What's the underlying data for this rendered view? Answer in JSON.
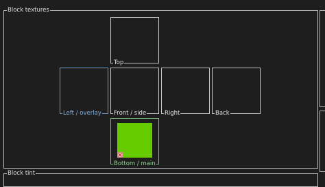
{
  "panels": {
    "block_textures_title": "Block textures",
    "block_tint_title": "Block tint"
  },
  "slots": {
    "top": "Top",
    "left": "Left / overlay",
    "front": "Front / side",
    "right": "Right",
    "back": "Back",
    "bottom": "Bottom / main"
  },
  "colors": {
    "bottom_texture": "#66cc00",
    "selected_left_border": "#6e9fcf",
    "selected_bottom_border": "#74b974"
  },
  "icons": {
    "remove": "close-icon"
  }
}
